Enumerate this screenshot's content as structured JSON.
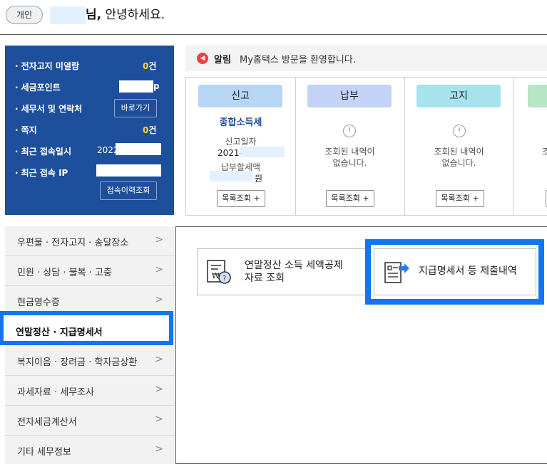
{
  "greeting": {
    "badge": "개인",
    "suffix_bold": "님,",
    "suffix": " 안녕하세요."
  },
  "info": {
    "rows": [
      {
        "label": "전자고지 미열람",
        "value_num": "0",
        "value_unit": "건"
      },
      {
        "label": "세금포인트",
        "value_tail": "p"
      },
      {
        "label": "세무서 및 연락처",
        "button": "바로가기"
      },
      {
        "label": "쪽지",
        "value_num": "0",
        "value_unit": "건"
      },
      {
        "label": "최근 접속일시",
        "value_prefix": "2022"
      },
      {
        "label": "최근 접속 IP"
      }
    ],
    "history_button": "접속이력조회"
  },
  "alert": {
    "title": "알림",
    "message": "My홈택스 방문을 환영합니다."
  },
  "status": [
    {
      "chip": "신고",
      "chip_color": "#b7d6f5",
      "title": "종합소득세",
      "date_label": "신고일자",
      "date_prefix": "2021-",
      "pay_label": "납부할세액",
      "pay_unit": "원",
      "list_button": "목록조회 +"
    },
    {
      "chip": "납부",
      "chip_color": "#c3d2f7",
      "empty_line1": "조회된 내역이",
      "empty_line2": "없습니다.",
      "list_button": "목록조회 +"
    },
    {
      "chip": "고지",
      "chip_color": "#a7e3ec",
      "empty_line1": "조회된 내역이",
      "empty_line2": "없습니다.",
      "list_button": "목록조회 +"
    },
    {
      "chip": "",
      "chip_color": "#b6e6c6",
      "empty_line1": "조",
      "list_button": ""
    }
  ],
  "menu": [
    {
      "label": "우편물 · 전자고지 · 송달장소"
    },
    {
      "label": "민원 · 상담 · 불복 · 고충"
    },
    {
      "label": "현금영수증"
    },
    {
      "label": "연말정산 · 지급명세서",
      "active": true
    },
    {
      "label": "복지이음 · 장려금 · 학자금상환"
    },
    {
      "label": "과세자료 · 세무조사"
    },
    {
      "label": "전자세금계산서"
    },
    {
      "label": "기타 세무정보"
    }
  ],
  "cards": [
    {
      "line1": "연말정산 소득 세액공제",
      "line2": "자료 조회",
      "icon": "tax-credit-search-icon"
    },
    {
      "line1": "지급명세서 등 제출내역",
      "icon": "document-submit-icon"
    }
  ],
  "colors": {
    "navy": "#1e4f9c",
    "highlight": "#1176f0",
    "yellow": "#ffd43b"
  }
}
